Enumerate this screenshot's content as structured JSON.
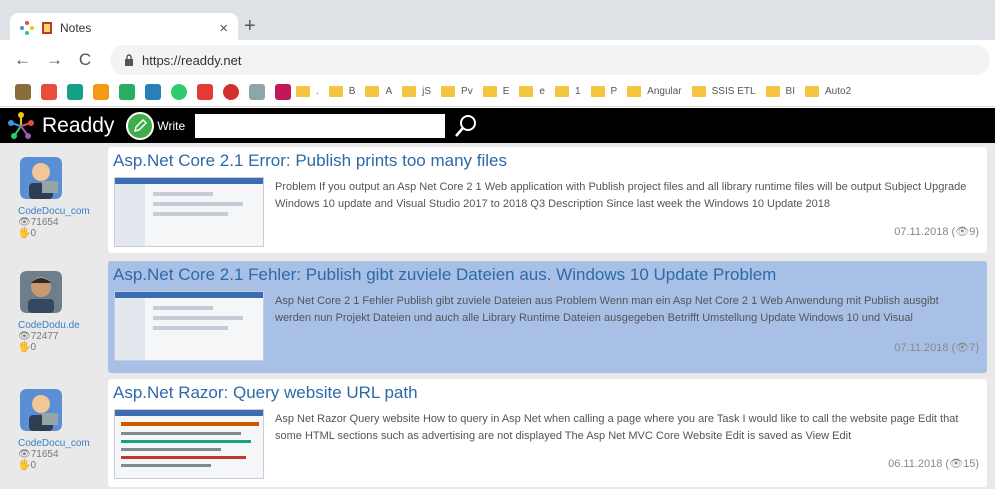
{
  "browser": {
    "tab_title": "Notes",
    "tab_close": "×",
    "new_tab": "+",
    "nav_back": "←",
    "nav_forward": "→",
    "nav_reload": "C",
    "url": "https://readdy.net"
  },
  "bookmarks": [
    "B",
    "A",
    "jS",
    "Pv",
    "E",
    "e",
    "1",
    "P",
    "Angular",
    "SSIS ETL",
    "BI",
    "Auto2"
  ],
  "header": {
    "site_name": "Readdy",
    "write_label": "Write",
    "search_value": ""
  },
  "posts": [
    {
      "author": "CodeDocu_com",
      "views": "71654",
      "likes": "0",
      "title": "Asp.Net Core 2.1 Error: Publish prints too many files",
      "excerpt": "Problem If you output an Asp Net Core 2 1 Web application with Publish project files and all library runtime files will be output Subject Upgrade Windows 10 update and Visual Studio 2017 to 2018 Q3 Description Since last week the Windows 10 Update 2018",
      "date": "07.11.2018",
      "count": "9"
    },
    {
      "author": "CodeDodu.de",
      "views": "72477",
      "likes": "0",
      "title": "Asp.Net Core 2.1 Fehler: Publish gibt zuviele Dateien aus. Windows 10 Update Problem",
      "excerpt": "Asp Net Core 2 1 Fehler Publish gibt zuviele Dateien aus Problem Wenn man ein Asp Net Core 2 1 Web Anwendung mit Publish ausgibt werden nun Projekt Dateien und auch alle Library Runtime Dateien ausgegeben Betrifft Umstellung Update Windows 10 und Visual",
      "date": "07.11.2018",
      "count": "7"
    },
    {
      "author": "CodeDocu_com",
      "views": "71654",
      "likes": "0",
      "title": "Asp.Net Razor: Query website URL path",
      "excerpt": "Asp Net Razor Query website How to query in Asp Net when calling a page where you are Task I would like to call the website page Edit that some HTML sections such as advertising are not displayed The Asp Net MVC Core Website Edit is saved as View Edit",
      "date": "06.11.2018",
      "count": "15"
    }
  ]
}
